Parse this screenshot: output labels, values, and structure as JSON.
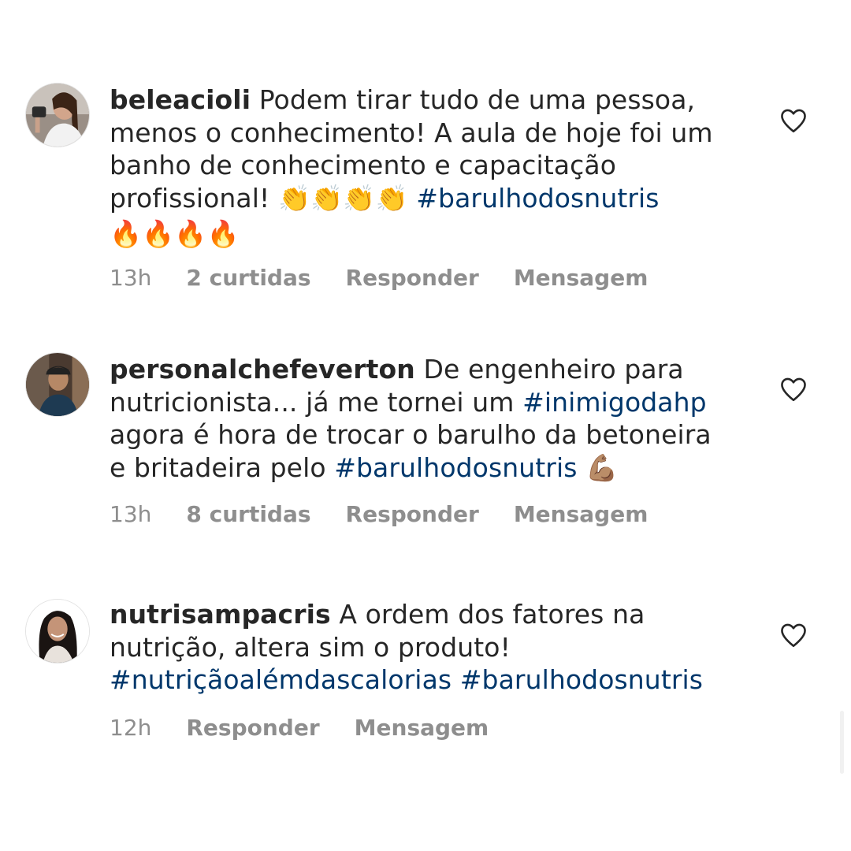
{
  "comments": [
    {
      "username": "beleacioli",
      "text_before": " Podem tirar tudo de uma pessoa, menos o conhecimento! A aula de hoje foi um banho de conhecimento e capacitação profissional! ",
      "emojis_inline": "👏👏👏👏",
      "hashtag1": "#barulhodosnutris",
      "emojis_after": "🔥🔥🔥🔥",
      "time": "13h",
      "likes": "2 curtidas",
      "reply": "Responder",
      "message": "Mensagem",
      "avatar_icon": "avatar-photo-woman-long-hair"
    },
    {
      "username": "personalchefeverton",
      "text_before": " De engenheiro para nutricionista... já me tornei um ",
      "hashtag1": "#inimigodahp",
      "text_middle": " agora é hora de trocar o barulho da betoneira e britadeira pelo ",
      "hashtag2": "#barulhodosnutris",
      "emoji_end": "💪🏽",
      "time": "13h",
      "likes": "8 curtidas",
      "reply": "Responder",
      "message": "Mensagem",
      "avatar_icon": "avatar-photo-man-cap"
    },
    {
      "username": "nutrisampacris",
      "text_before": " A ordem dos fatores na nutrição, altera sim o produto! ",
      "hashtag1": "#nutriçãoalémdascalorias",
      "hashtag2": "#barulhodosnutris",
      "time": "12h",
      "reply": "Responder",
      "message": "Mensagem",
      "avatar_icon": "avatar-photo-woman-dark-hair"
    }
  ],
  "colors": {
    "text": "#262626",
    "hashtag": "#00376b",
    "meta": "#8e8e8e",
    "background": "#ffffff"
  },
  "icons": {
    "like": "heart-outline-icon"
  }
}
